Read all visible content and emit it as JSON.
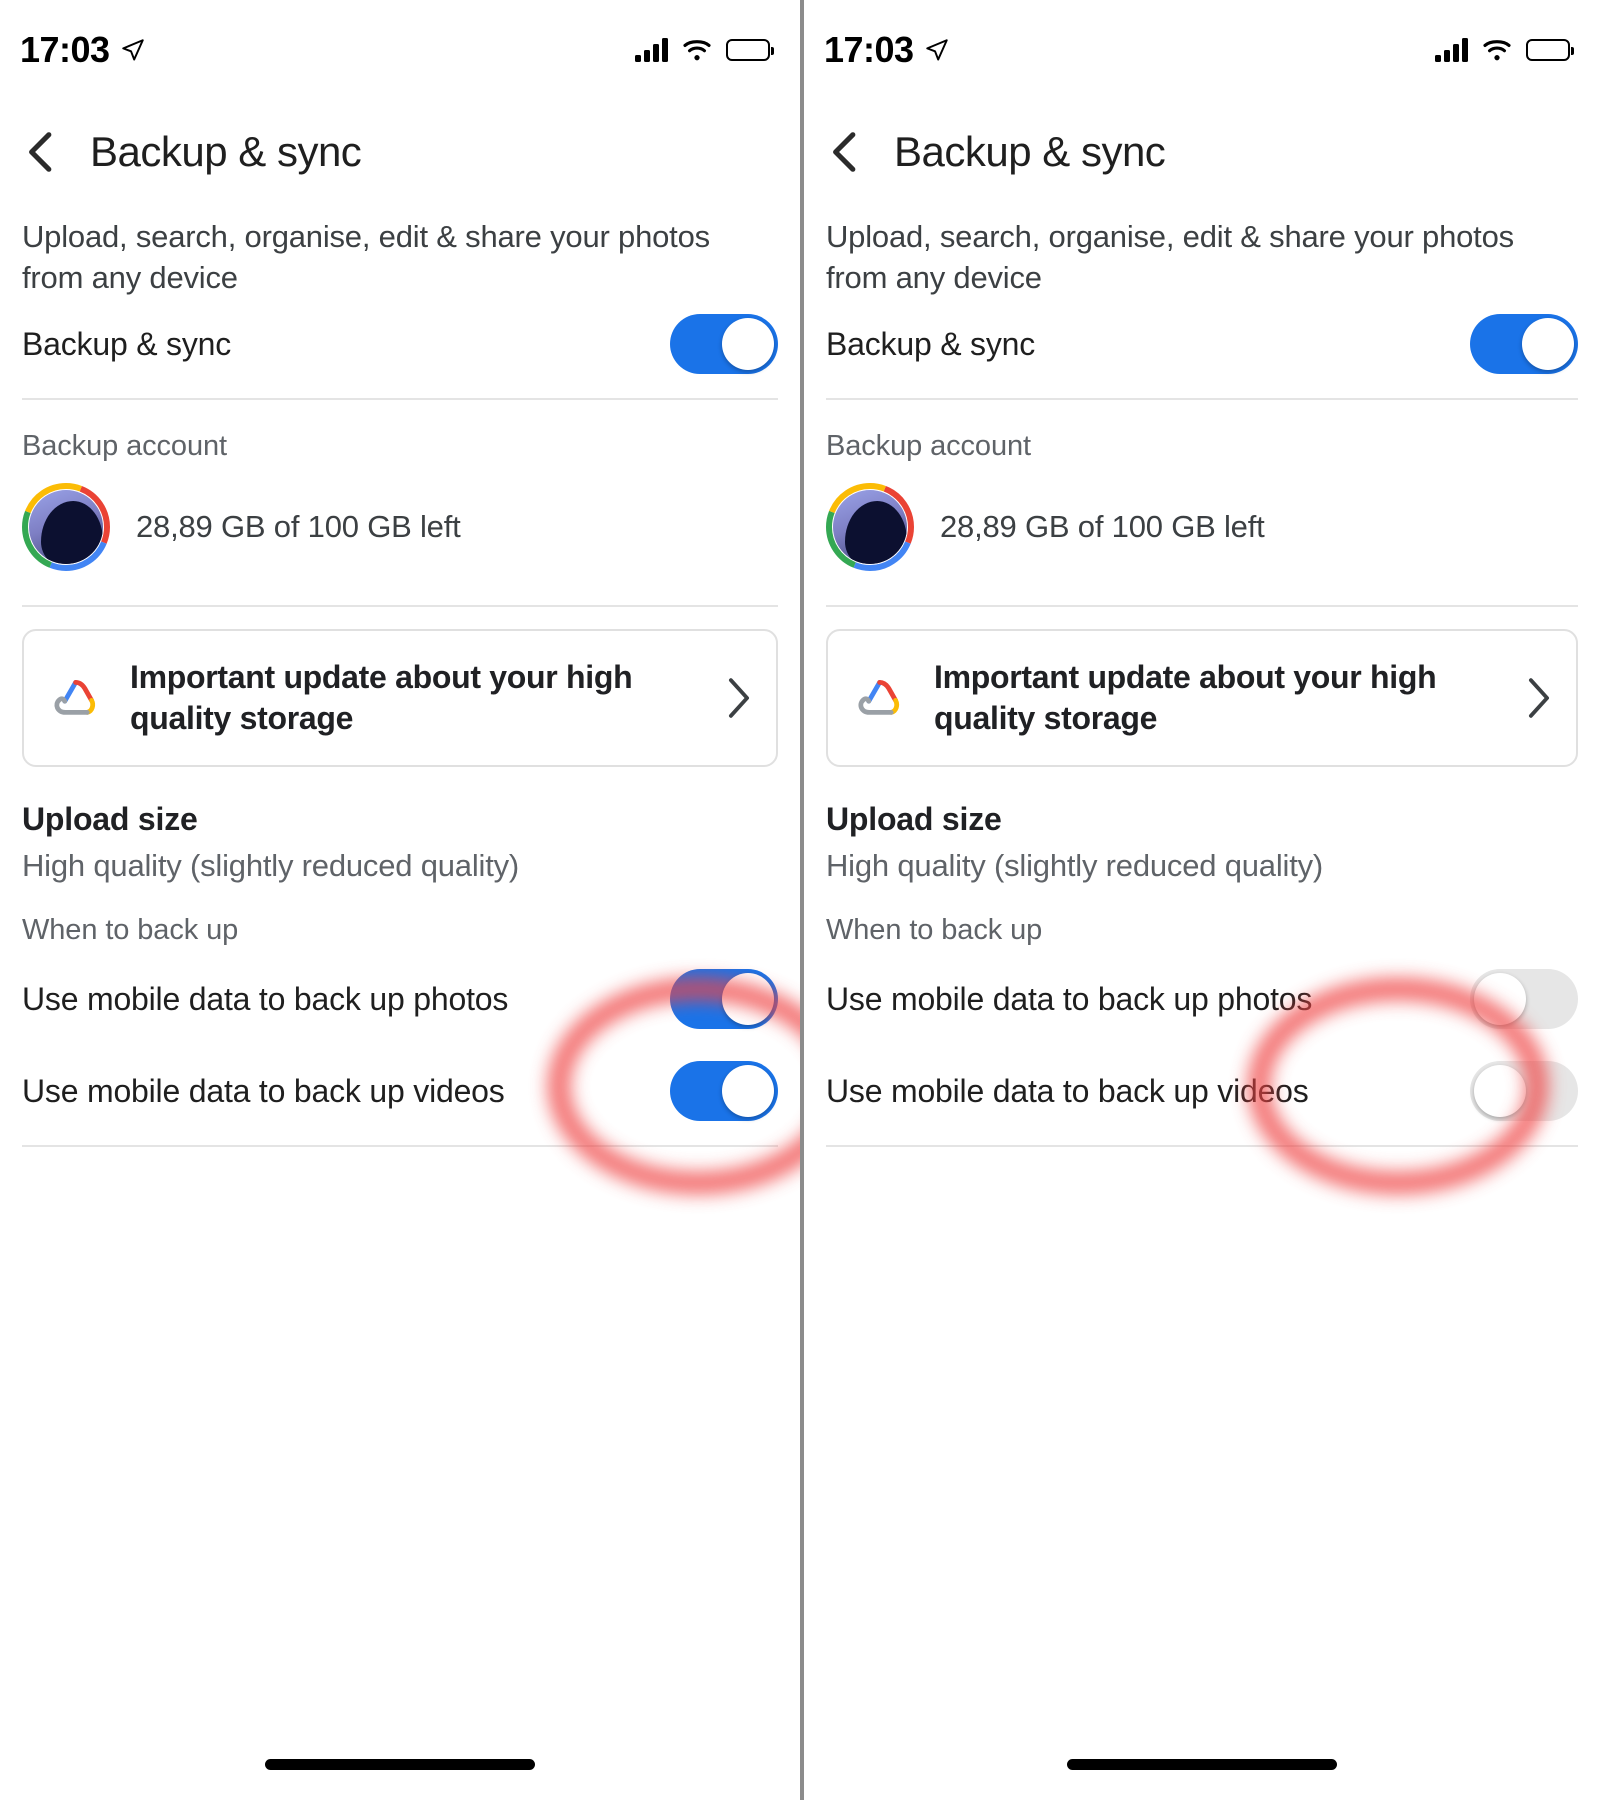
{
  "colors": {
    "accent_blue": "#1a73e8",
    "toggle_off": "#e6e6e6",
    "annotation_red": "#ef4444",
    "text_primary": "#1f1f1f",
    "text_secondary": "#5f6368",
    "divider": "#e4e4e4"
  },
  "panels": [
    {
      "id": "left",
      "status_bar": {
        "time": "17:03",
        "location_icon": "location-arrow-icon",
        "signal_icon": "cellular-signal-icon",
        "wifi_icon": "wifi-icon",
        "battery_icon": "battery-icon"
      },
      "nav": {
        "back_icon": "chevron-left-icon",
        "title": "Backup & sync"
      },
      "intro": "Upload, search, organise, edit & share your photos from any device",
      "backup_sync_row": {
        "label": "Backup & sync",
        "toggle_state": "on"
      },
      "account": {
        "caption": "Backup account",
        "avatar_icon": "avatar",
        "name_redacted": "",
        "storage": "28,89 GB of 100 GB left"
      },
      "promo": {
        "icon": "google-cloud-icon",
        "text": "Important update about your high quality storage",
        "chevron_icon": "chevron-right-icon"
      },
      "upload_size": {
        "title": "Upload size",
        "value": "High quality (slightly reduced quality)"
      },
      "when_to_backup": {
        "caption": "When to back up",
        "rows": [
          {
            "label": "Use mobile data to back up photos",
            "toggle_state": "on"
          },
          {
            "label": "Use mobile data to back up videos",
            "toggle_state": "on"
          }
        ]
      },
      "annotation": "red-highlight-circle"
    },
    {
      "id": "right",
      "status_bar": {
        "time": "17:03",
        "location_icon": "location-arrow-icon",
        "signal_icon": "cellular-signal-icon",
        "wifi_icon": "wifi-icon",
        "battery_icon": "battery-icon"
      },
      "nav": {
        "back_icon": "chevron-left-icon",
        "title": "Backup & sync"
      },
      "intro": "Upload, search, organise, edit & share your photos from any device",
      "backup_sync_row": {
        "label": "Backup & sync",
        "toggle_state": "on"
      },
      "account": {
        "caption": "Backup account",
        "avatar_icon": "avatar",
        "name_redacted": "",
        "storage": "28,89 GB of 100 GB left"
      },
      "promo": {
        "icon": "google-cloud-icon",
        "text": "Important update about your high quality storage",
        "chevron_icon": "chevron-right-icon"
      },
      "upload_size": {
        "title": "Upload size",
        "value": "High quality (slightly reduced quality)"
      },
      "when_to_backup": {
        "caption": "When to back up",
        "rows": [
          {
            "label": "Use mobile data to back up photos",
            "toggle_state": "off"
          },
          {
            "label": "Use mobile data to back up videos",
            "toggle_state": "off"
          }
        ]
      },
      "annotation": "red-highlight-circle"
    }
  ]
}
